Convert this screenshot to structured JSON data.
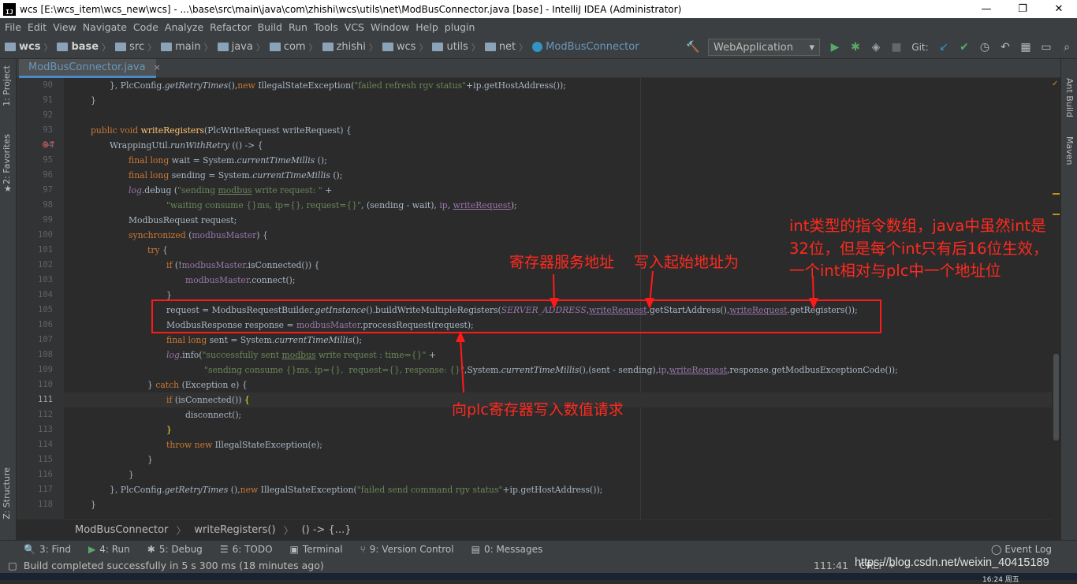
{
  "window": {
    "title": "wcs [E:\\wcs_item\\wcs_new\\wcs] - ...\\base\\src\\main\\java\\com\\zhishi\\wcs\\utils\\net\\ModBusConnector.java [base] - IntelliJ IDEA (Administrator)",
    "app_icon": "IJ",
    "minimize": "—",
    "maximize": "❐",
    "close": "✕"
  },
  "menu": [
    "File",
    "Edit",
    "View",
    "Navigate",
    "Code",
    "Analyze",
    "Refactor",
    "Build",
    "Run",
    "Tools",
    "VCS",
    "Window",
    "Help",
    "plugin"
  ],
  "nav": {
    "crumbs": [
      "wcs",
      "base",
      "src",
      "main",
      "java",
      "com",
      "zhishi",
      "wcs",
      "utils",
      "net"
    ],
    "class": "ModBusConnector",
    "run_config": "WebApplication",
    "git_label": "Git:"
  },
  "left_tabs": {
    "project": "1: Project",
    "favorites": "2: Favorites",
    "structure": "Z: Structure"
  },
  "right_tabs": {
    "ant": "Ant Build",
    "maven": "Maven"
  },
  "tab": {
    "label": "ModBusConnector.java",
    "close": "×"
  },
  "line_numbers": [
    "90",
    "91",
    "92",
    "93",
    "94",
    "95",
    "96",
    "97",
    "98",
    "99",
    "100",
    "101",
    "102",
    "103",
    "104",
    "105",
    "106",
    "107",
    "108",
    "109",
    "110",
    "111",
    "112",
    "113",
    "114",
    "115",
    "116",
    "117",
    "118"
  ],
  "breadcrumb": [
    "ModBusConnector",
    "writeRegisters()",
    "() -> {...}"
  ],
  "bottom_tools": [
    {
      "icon": "search-icon",
      "glyph": "🔍",
      "label": "3: Find"
    },
    {
      "icon": "run-icon",
      "glyph": "▶",
      "label": "4: Run"
    },
    {
      "icon": "bug-icon",
      "glyph": "✱",
      "label": "5: Debug"
    },
    {
      "icon": "todo-icon",
      "glyph": "☰",
      "label": "6: TODO"
    },
    {
      "icon": "terminal-icon",
      "glyph": "▣",
      "label": "Terminal"
    },
    {
      "icon": "vcs-icon",
      "glyph": "⑂",
      "label": "9: Version Control"
    },
    {
      "icon": "messages-icon",
      "glyph": "▤",
      "label": "0: Messages"
    }
  ],
  "event_log": "Event Log",
  "status": {
    "message": "Build completed successfully in 5 s 300 ms (18 minutes ago)",
    "position": "111:41",
    "line_sep": "CRLF ÷",
    "watermark": "https://blog.csdn.net/weixin_40415189",
    "clock": "16:24 周五"
  },
  "annotations": {
    "server_addr": "寄存器服务地址",
    "start_addr": "写入起始地址为",
    "int_note_1": "int类型的指令数组，java中虽然int是",
    "int_note_2": "32位，但是每个int只有后16位生效，",
    "int_note_3": "一个int相对与plc中一个地址位",
    "request_note": "向plc寄存器写入数值请求"
  },
  "colors": {
    "keyword": "#cc7832",
    "string": "#6a8759",
    "field": "#9876aa",
    "method": "#ffc66d",
    "annotation": "#ff2a1f"
  }
}
